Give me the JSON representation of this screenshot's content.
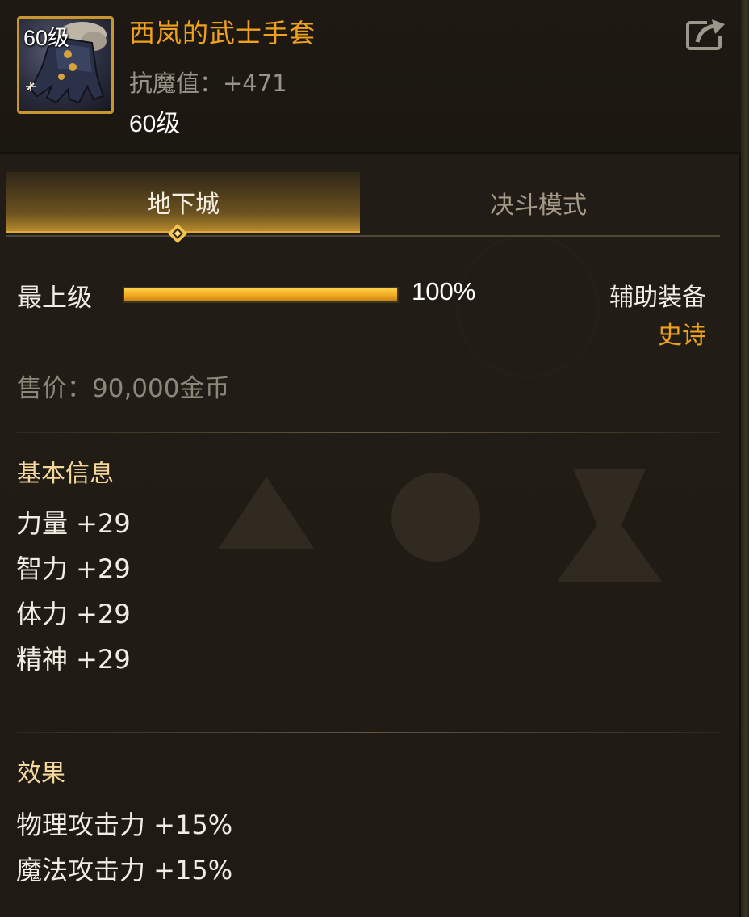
{
  "header": {
    "icon_level": "60级",
    "item_name": "西岚的武士手套",
    "resist_stat": "抗魔值：+471",
    "level": "60级"
  },
  "tabs": [
    {
      "label": "地下城",
      "active": true
    },
    {
      "label": "决斗模式",
      "active": false
    }
  ],
  "upgrade": {
    "label": "最上级",
    "progress_percent": 100,
    "progress_text": "100%"
  },
  "equipment": {
    "type": "辅助装备",
    "rarity": "史诗"
  },
  "price": "售价：90,000金币",
  "basic_info": {
    "title": "基本信息",
    "stats": [
      "力量 +29",
      "智力 +29",
      "体力 +29",
      "精神 +29"
    ]
  },
  "effects": {
    "title": "效果",
    "lines": [
      "物理攻击力 +15%",
      "魔法攻击力 +15%"
    ]
  },
  "colors": {
    "accent_gold": "#f0a21e",
    "frame_gold": "#c8962c",
    "text_light": "#f2ede2",
    "text_muted": "#8d877a"
  },
  "icons": [
    "glove-item-icon",
    "share-icon",
    "diamond-marker-icon"
  ]
}
